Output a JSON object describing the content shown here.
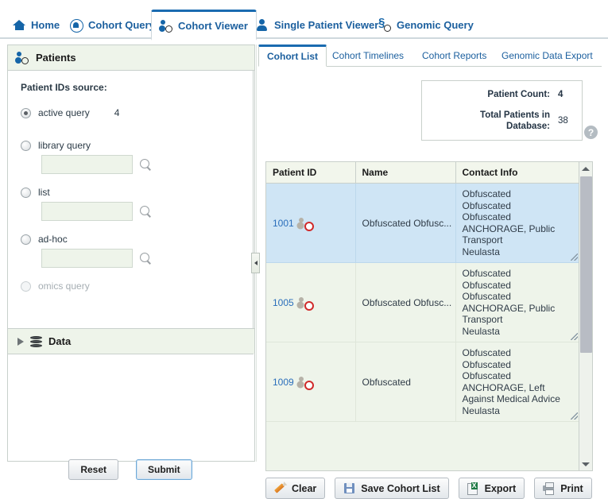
{
  "nav": {
    "tabs": [
      {
        "label": "Home",
        "icon": "home-icon",
        "active": false
      },
      {
        "label": "Cohort Query",
        "icon": "cohort-query-icon",
        "active": false
      },
      {
        "label": "Cohort Viewer",
        "icon": "cohort-viewer-icon",
        "active": true
      },
      {
        "label": "Single Patient Viewer",
        "icon": "person-icon",
        "active": false
      },
      {
        "label": "Genomic Query",
        "icon": "genomic-query-icon",
        "active": false
      }
    ]
  },
  "sidebar": {
    "title": "Patients",
    "title_icon": "patients-icon",
    "source_label": "Patient IDs source:",
    "options": [
      {
        "label": "active query",
        "checked": true,
        "count": "4",
        "has_input": false,
        "disabled": false
      },
      {
        "label": "library query",
        "checked": false,
        "value": "",
        "placeholder": "",
        "has_input": true,
        "disabled": false
      },
      {
        "label": "list",
        "checked": false,
        "value": "",
        "placeholder": "",
        "has_input": true,
        "disabled": false
      },
      {
        "label": "ad-hoc",
        "checked": false,
        "value": "",
        "placeholder": "",
        "has_input": true,
        "disabled": false
      },
      {
        "label": "omics query",
        "checked": false,
        "has_input": false,
        "disabled": true
      }
    ],
    "data_section": {
      "label": "Data",
      "icon": "database-icon",
      "expanded": false
    },
    "buttons": {
      "reset": "Reset",
      "submit": "Submit"
    }
  },
  "main": {
    "tabs": [
      {
        "label": "Cohort List",
        "active": true
      },
      {
        "label": "Cohort Timelines",
        "active": false
      },
      {
        "label": "Cohort Reports",
        "active": false
      },
      {
        "label": "Genomic Data Export",
        "active": false
      }
    ],
    "counts": {
      "patient_count_label": "Patient Count:",
      "patient_count_value": "4",
      "total_patients_label": "Total Patients in Database:",
      "total_patients_value": "38",
      "help_glyph": "?"
    },
    "table": {
      "columns": [
        "Patient ID",
        "Name",
        "Contact Info"
      ],
      "rows": [
        {
          "patient_id": "1001",
          "name": "Obfuscated Obfusc...",
          "contact": "Obfuscated\nObfuscated\nObfuscated\nANCHORAGE, Public Transport\nNeulasta",
          "selected": true
        },
        {
          "patient_id": "1005",
          "name": "Obfuscated Obfusc...",
          "contact": "Obfuscated\nObfuscated\nObfuscated\nANCHORAGE, Public Transport\nNeulasta",
          "selected": false
        },
        {
          "patient_id": "1009",
          "name": "Obfuscated",
          "contact": "Obfuscated\nObfuscated\nObfuscated\nANCHORAGE, Left Against Medical Advice\nNeulasta",
          "selected": false
        }
      ]
    },
    "actions": [
      {
        "label": "Clear",
        "icon": "eraser-icon"
      },
      {
        "label": "Save Cohort List",
        "icon": "floppy-disk-icon"
      },
      {
        "label": "Export",
        "icon": "excel-export-icon"
      },
      {
        "label": "Print",
        "icon": "printer-icon"
      }
    ]
  },
  "colors": {
    "link_blue": "#1b5f9e",
    "active_tab_blue": "#1a6bb0",
    "panel_green": "#eef4ea",
    "selected_row_blue": "#cfe5f5"
  }
}
